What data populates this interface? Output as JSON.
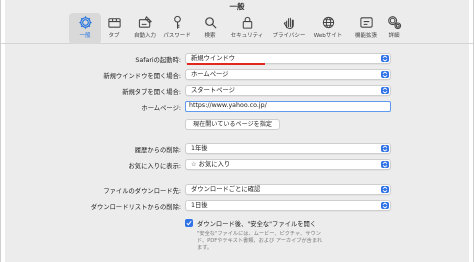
{
  "window": {
    "title": "一般"
  },
  "toolbar": {
    "items": [
      {
        "label": "一般",
        "icon": "gear-icon",
        "active": true
      },
      {
        "label": "タブ",
        "icon": "tabs-icon"
      },
      {
        "label": "自動入力",
        "icon": "autofill-icon"
      },
      {
        "label": "パスワード",
        "icon": "key-icon"
      },
      {
        "label": "検索",
        "icon": "search-icon"
      },
      {
        "label": "セキュリティ",
        "icon": "lock-icon"
      },
      {
        "label": "プライバシー",
        "icon": "hand-icon"
      },
      {
        "label": "Webサイト",
        "icon": "globe-icon"
      },
      {
        "label": "機能拡張",
        "icon": "extensions-icon"
      },
      {
        "label": "詳細",
        "icon": "advanced-gear-icon"
      }
    ]
  },
  "settings": {
    "startup_label": "Safariの起動時:",
    "startup_value": "新規ウインドウ",
    "new_window_label": "新規ウインドウを開く場合:",
    "new_window_value": "ホームページ",
    "new_tab_label": "新規タブを開く場合:",
    "new_tab_value": "スタートページ",
    "homepage_label": "ホームページ:",
    "homepage_value": "https://www.yahoo.co.jp/",
    "set_current_button": "現在開いているページを指定",
    "history_label": "履歴からの削除:",
    "history_value": "1年後",
    "favorites_label": "お気に入りに表示:",
    "favorites_value": "お気に入り",
    "download_dest_label": "ファイルのダウンロード先:",
    "download_dest_value": "ダウンロードごとに確認",
    "download_list_label": "ダウンロードリストからの削除:",
    "download_list_value": "1日後",
    "open_safe_files_label": "ダウンロード後、\"安全な\"ファイルを開く",
    "open_safe_files_checked": true,
    "note_line1": "\"安全な\"ファイルには、ムービー、ピクチャ、サウン",
    "note_line2": "ド、PDFやテキスト書類、および アーカイブが含まれ",
    "note_line3": "ます。"
  },
  "colors": {
    "accent": "#2f73e6",
    "annotation_underline": "#e0281e"
  }
}
